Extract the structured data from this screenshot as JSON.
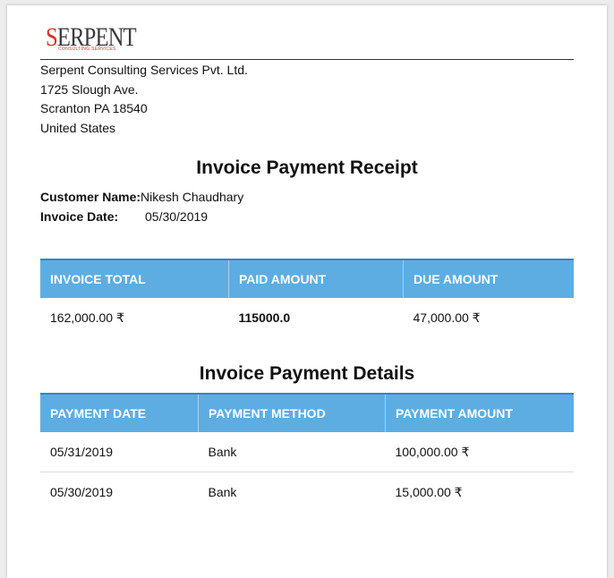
{
  "logo": {
    "main_first": "S",
    "main_rest": "ERPENT",
    "tagline": "CONSULTING SERVICES"
  },
  "company": {
    "name": "Serpent Consulting Services Pvt. Ltd.",
    "street": "1725 Slough Ave.",
    "city": "Scranton PA 18540",
    "country": "United States"
  },
  "receipt": {
    "title": "Invoice Payment Receipt",
    "customer_label": "Customer Name:",
    "customer_value": "Nikesh Chaudhary",
    "date_label": "Invoice Date:",
    "date_value": "05/30/2019"
  },
  "summary": {
    "headers": [
      "INVOICE TOTAL",
      "PAID AMOUNT",
      "DUE AMOUNT"
    ],
    "invoice_total": "162,000.00 ₹",
    "paid_amount": "115000.0",
    "due_amount": "47,000.00 ₹"
  },
  "details": {
    "title": "Invoice Payment Details",
    "headers": [
      "PAYMENT DATE",
      "PAYMENT METHOD",
      "PAYMENT AMOUNT"
    ],
    "rows": [
      {
        "date": "05/31/2019",
        "method": "Bank",
        "amount": "100,000.00 ₹"
      },
      {
        "date": "05/30/2019",
        "method": "Bank",
        "amount": "15,000.00 ₹"
      }
    ]
  },
  "colors": {
    "header_bg": "#5dade2",
    "logo_red": "#d6322a"
  }
}
